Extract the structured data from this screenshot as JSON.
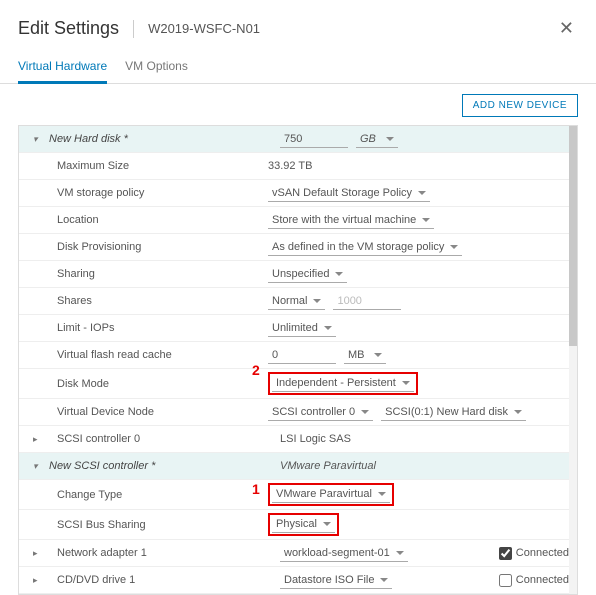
{
  "header": {
    "title": "Edit Settings",
    "subtitle": "W2019-WSFC-N01"
  },
  "tabs": {
    "hw": "Virtual Hardware",
    "opts": "VM Options"
  },
  "toolbar": {
    "add": "ADD NEW DEVICE"
  },
  "markers": {
    "one": "1",
    "two": "2"
  },
  "rows": {
    "newdisk": {
      "label": "New Hard disk *",
      "size": "750",
      "unit": "GB"
    },
    "maxsize": {
      "label": "Maximum Size",
      "value": "33.92 TB"
    },
    "policy": {
      "label": "VM storage policy",
      "value": "vSAN Default Storage Policy"
    },
    "location": {
      "label": "Location",
      "value": "Store with the virtual machine"
    },
    "prov": {
      "label": "Disk Provisioning",
      "value": "As defined in the VM storage policy"
    },
    "sharing": {
      "label": "Sharing",
      "value": "Unspecified"
    },
    "shares": {
      "label": "Shares",
      "value": "Normal",
      "num": "1000"
    },
    "iops": {
      "label": "Limit - IOPs",
      "value": "Unlimited"
    },
    "flash": {
      "label": "Virtual flash read cache",
      "num": "0",
      "unit": "MB"
    },
    "mode": {
      "label": "Disk Mode",
      "value": "Independent - Persistent"
    },
    "node": {
      "label": "Virtual Device Node",
      "ctrl": "SCSI controller 0",
      "slot": "SCSI(0:1) New Hard disk"
    },
    "scsi0": {
      "label": "SCSI controller 0",
      "value": "LSI Logic SAS"
    },
    "newscsi": {
      "label": "New SCSI controller *",
      "value": "VMware Paravirtual"
    },
    "chtype": {
      "label": "Change Type",
      "value": "VMware Paravirtual"
    },
    "bus": {
      "label": "SCSI Bus Sharing",
      "value": "Physical"
    },
    "net": {
      "label": "Network adapter 1",
      "value": "workload-segment-01",
      "conn": "Connected"
    },
    "cd": {
      "label": "CD/DVD drive 1",
      "value": "Datastore ISO File",
      "conn": "Connected"
    }
  }
}
